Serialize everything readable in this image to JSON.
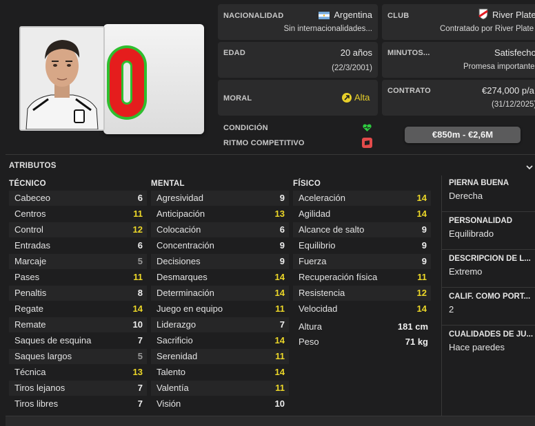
{
  "nationality": {
    "label": "NACIONALIDAD",
    "country": "Argentina",
    "caps": "Sin internacionalidades..."
  },
  "club": {
    "label": "CLUB",
    "name": "River Plate",
    "contract_note": "Contratado por River Plate"
  },
  "age": {
    "label": "EDAD",
    "value": "20 años",
    "dob": "(22/3/2001)"
  },
  "minutes": {
    "label": "MINUTOS...",
    "status": "Satisfecho",
    "note": "Promesa importante"
  },
  "morale": {
    "label": "MORAL",
    "value": "Alta"
  },
  "contract": {
    "label": "CONTRATO",
    "wage": "€274,000 p/a",
    "expiry": "(31/12/2025)"
  },
  "condition": {
    "label": "CONDICIÓN"
  },
  "match_sharpness": {
    "label": "RITMO COMPETITIVO"
  },
  "value_range": "€850m - €2,6M",
  "attributes_title": "ATRIBUTOS",
  "columns": {
    "technical": {
      "title": "TÉCNICO",
      "rows": [
        {
          "name": "Cabeceo",
          "value": "6",
          "tier": "white"
        },
        {
          "name": "Centros",
          "value": "11",
          "tier": "yellow"
        },
        {
          "name": "Control",
          "value": "12",
          "tier": "yellow"
        },
        {
          "name": "Entradas",
          "value": "6",
          "tier": "white"
        },
        {
          "name": "Marcaje",
          "value": "5",
          "tier": "grey"
        },
        {
          "name": "Pases",
          "value": "11",
          "tier": "yellow"
        },
        {
          "name": "Penaltis",
          "value": "8",
          "tier": "white"
        },
        {
          "name": "Regate",
          "value": "14",
          "tier": "yellow"
        },
        {
          "name": "Remate",
          "value": "10",
          "tier": "white"
        },
        {
          "name": "Saques de esquina",
          "value": "7",
          "tier": "white"
        },
        {
          "name": "Saques largos",
          "value": "5",
          "tier": "grey"
        },
        {
          "name": "Técnica",
          "value": "13",
          "tier": "yellow"
        },
        {
          "name": "Tiros lejanos",
          "value": "7",
          "tier": "white"
        },
        {
          "name": "Tiros libres",
          "value": "7",
          "tier": "white"
        }
      ]
    },
    "mental": {
      "title": "MENTAL",
      "rows": [
        {
          "name": "Agresividad",
          "value": "9",
          "tier": "white"
        },
        {
          "name": "Anticipación",
          "value": "13",
          "tier": "yellow"
        },
        {
          "name": "Colocación",
          "value": "6",
          "tier": "white"
        },
        {
          "name": "Concentración",
          "value": "9",
          "tier": "white"
        },
        {
          "name": "Decisiones",
          "value": "9",
          "tier": "white"
        },
        {
          "name": "Desmarques",
          "value": "14",
          "tier": "yellow"
        },
        {
          "name": "Determinación",
          "value": "14",
          "tier": "yellow"
        },
        {
          "name": "Juego en equipo",
          "value": "11",
          "tier": "yellow"
        },
        {
          "name": "Liderazgo",
          "value": "7",
          "tier": "white"
        },
        {
          "name": "Sacrificio",
          "value": "14",
          "tier": "yellow"
        },
        {
          "name": "Serenidad",
          "value": "11",
          "tier": "yellow"
        },
        {
          "name": "Talento",
          "value": "14",
          "tier": "yellow"
        },
        {
          "name": "Valentía",
          "value": "11",
          "tier": "yellow"
        },
        {
          "name": "Visión",
          "value": "10",
          "tier": "white"
        }
      ]
    },
    "physical": {
      "title": "FÍSICO",
      "rows": [
        {
          "name": "Aceleración",
          "value": "14",
          "tier": "yellow"
        },
        {
          "name": "Agilidad",
          "value": "14",
          "tier": "yellow"
        },
        {
          "name": "Alcance de salto",
          "value": "9",
          "tier": "white"
        },
        {
          "name": "Equilibrio",
          "value": "9",
          "tier": "white"
        },
        {
          "name": "Fuerza",
          "value": "9",
          "tier": "white"
        },
        {
          "name": "Recuperación física",
          "value": "11",
          "tier": "yellow"
        },
        {
          "name": "Resistencia",
          "value": "12",
          "tier": "yellow"
        },
        {
          "name": "Velocidad",
          "value": "14",
          "tier": "yellow"
        }
      ],
      "height_label": "Altura",
      "height_value": "181 cm",
      "weight_label": "Peso",
      "weight_value": "71 kg"
    }
  },
  "side": [
    {
      "label": "PIERNA BUENA",
      "value": "Derecha"
    },
    {
      "label": "PERSONALIDAD",
      "value": "Equilibrado"
    },
    {
      "label": "DESCRIPCIÓN DE L...",
      "value": "Extremo"
    },
    {
      "label": "CALIF. COMO PORT...",
      "value": "2"
    },
    {
      "label": "CUALIDADES DE JU...",
      "value": "Hace paredes"
    }
  ],
  "colors": {
    "yellow": "#ecd728",
    "green": "#2ecc40",
    "red": "#e34b4b",
    "bg": "#1e1e1f"
  }
}
